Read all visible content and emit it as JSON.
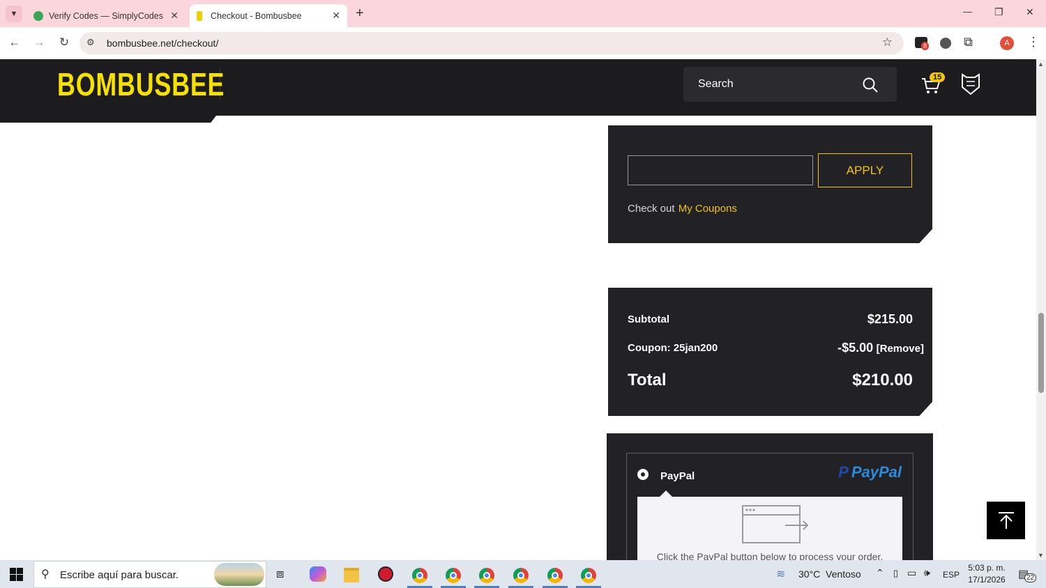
{
  "browser": {
    "tabs": [
      {
        "title": "Verify Codes — SimplyCodes",
        "close": "✕"
      },
      {
        "title": "Checkout - Bombusbee",
        "close": "✕"
      }
    ],
    "new_tab": "+",
    "url": "bombusbee.net/checkout/",
    "extension_badge": "8",
    "profile_initial": "A",
    "window_controls": {
      "minimize": "—",
      "restore": "❐",
      "close": "✕"
    }
  },
  "site": {
    "logo": "BOMBUSBEE",
    "search_placeholder": "Search",
    "cart_count": "15"
  },
  "coupon": {
    "apply_label": "APPLY",
    "checkout_text": "Check out",
    "my_coupons_link": "My Coupons"
  },
  "totals": {
    "subtotal_label": "Subtotal",
    "subtotal_value": "$215.00",
    "coupon_label": "Coupon: 25jan200",
    "coupon_value": "-$5.00",
    "remove_label": "[Remove]",
    "total_label": "Total",
    "total_value": "$210.00"
  },
  "payment": {
    "method_label": "PayPal",
    "paypal_logo": "PayPal",
    "info_text": "Click the PayPal button below to process your order."
  },
  "taskbar": {
    "search_placeholder": "Escribe aquí para buscar.",
    "weather": "30°C  Ventoso",
    "language": "ESP",
    "time": "5:03 p. m.",
    "date": "17/1/2026",
    "notifications": "22"
  },
  "colors": {
    "accent_yellow": "#f0c419",
    "panel_bg": "#212126",
    "header_bg": "#1c1c1f",
    "tabbar_bg": "#fbd7dd"
  }
}
